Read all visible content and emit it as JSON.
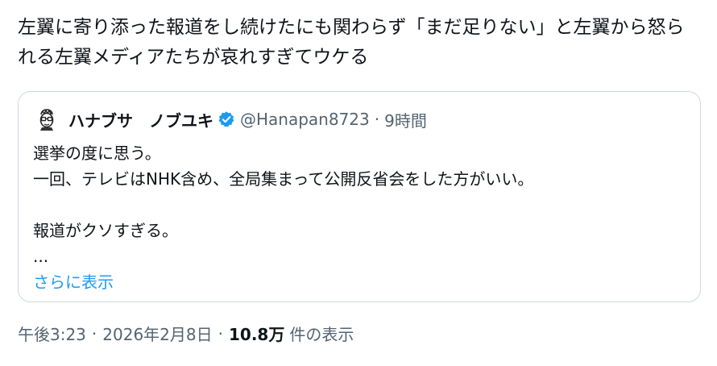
{
  "tweet": {
    "text": "左翼に寄り添った報道をし続けたにも関わらず「まだ足りない」と左翼から怒られる左翼メディアたちが哀れすぎてウケる"
  },
  "quote": {
    "avatar_icon": "cartoon-face-with-glasses-icon",
    "display_name": "ハナブサ　ノブユキ",
    "verified_icon": "verified-badge-icon",
    "handle": "@Hanapan8723",
    "separator": "·",
    "time": "9時間",
    "lines": [
      "選挙の度に思う。",
      "一回、テレビはNHK含め、全局集まって公開反省会をした方がいい。",
      "",
      "報道がクソすぎる。",
      "..."
    ],
    "show_more": "さらに表示"
  },
  "meta": {
    "time": "午後3:23",
    "separator": "·",
    "date": "2026年2月8日",
    "views": "10.8万",
    "views_label": "件の表示"
  },
  "colors": {
    "text": "#0f1419",
    "secondary": "#536471",
    "link": "#1d9bf0",
    "border": "#cfd9de",
    "verified": "#1d9bf0"
  }
}
